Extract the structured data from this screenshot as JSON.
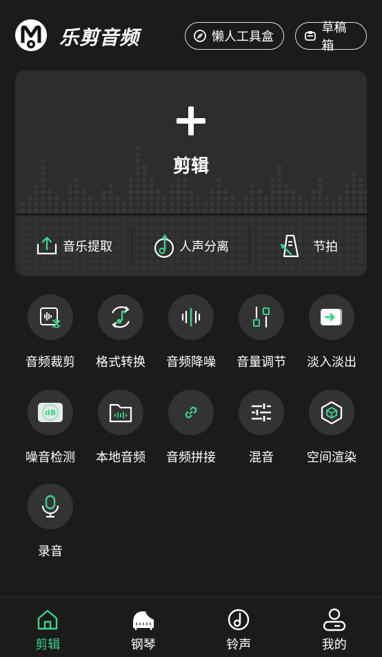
{
  "header": {
    "brand": "乐剪音频",
    "toolbox_label": "懒人工具盒",
    "drafts_label": "草稿箱"
  },
  "card": {
    "create_label": "剪辑",
    "actions": [
      {
        "label": "音乐提取",
        "icon": "upload-icon"
      },
      {
        "label": "人声分离",
        "icon": "vocal-separate-icon"
      },
      {
        "label": "节拍",
        "icon": "metronome-icon"
      }
    ]
  },
  "tools": [
    {
      "label": "音频裁剪",
      "icon": "audio-cut-icon"
    },
    {
      "label": "格式转换",
      "icon": "format-convert-icon"
    },
    {
      "label": "音频降噪",
      "icon": "noise-reduction-icon"
    },
    {
      "label": "音量调节",
      "icon": "volume-adjust-icon"
    },
    {
      "label": "淡入淡出",
      "icon": "fade-icon"
    },
    {
      "label": "噪音检测",
      "icon": "db-meter-icon"
    },
    {
      "label": "本地音频",
      "icon": "folder-icon"
    },
    {
      "label": "音频拼接",
      "icon": "link-icon"
    },
    {
      "label": "混音",
      "icon": "mixer-icon"
    },
    {
      "label": "空间渲染",
      "icon": "cube-icon"
    },
    {
      "label": "录音",
      "icon": "microphone-icon"
    }
  ],
  "tabs": [
    {
      "label": "剪辑",
      "icon": "home-icon",
      "active": true
    },
    {
      "label": "钢琴",
      "icon": "piano-icon",
      "active": false
    },
    {
      "label": "铃声",
      "icon": "ringtone-icon",
      "active": false
    },
    {
      "label": "我的",
      "icon": "profile-icon",
      "active": false
    }
  ],
  "colors": {
    "accent": "#3ed38b",
    "background": "#1b1b1b",
    "card": "#2d2d2d",
    "circle": "#333333"
  }
}
